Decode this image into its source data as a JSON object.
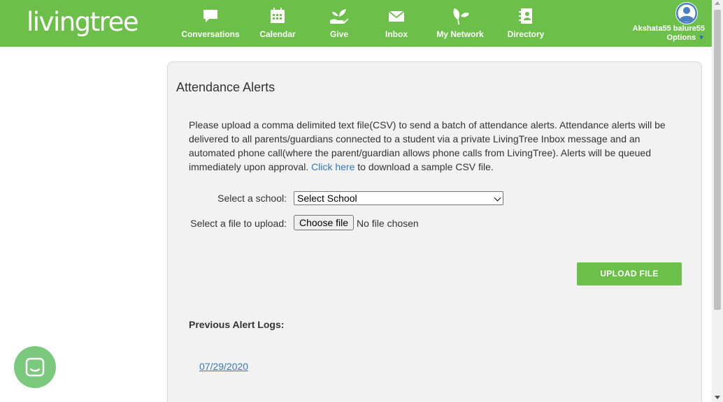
{
  "header": {
    "logo_text": "livingtree",
    "brand_color": "#6cc04a",
    "nav": [
      {
        "label": "Conversations",
        "icon": "speech-bubble-icon"
      },
      {
        "label": "Calendar",
        "icon": "calendar-icon"
      },
      {
        "label": "Give",
        "icon": "hand-plant-icon"
      },
      {
        "label": "Inbox",
        "icon": "envelope-icon"
      },
      {
        "label": "My Network",
        "icon": "leaves-icon"
      },
      {
        "label": "Directory",
        "icon": "contact-book-icon"
      }
    ],
    "user": {
      "name": "Akshata55 balure55",
      "options_label": "Options"
    }
  },
  "main": {
    "title": "Attendance Alerts",
    "description_before_link": "Please upload a comma delimited text file(CSV) to send a batch of attendance alerts. Attendance alerts will be delivered to all parents/guardians connected to a student via a private LivingTree Inbox message and an automated phone call(where the parent/guardian allows phone calls from LivingTree). Alerts will be queued immediately upon approval. ",
    "description_link": "Click here",
    "description_after_link": " to download a sample CSV file.",
    "school_label": "Select a school:",
    "school_selected": "Select School",
    "file_label": "Select a file to upload:",
    "choose_file_label": "Choose file",
    "file_status": "No file chosen",
    "upload_button": "UPLOAD FILE",
    "logs_title": "Previous Alert Logs:",
    "logs": [
      "07/29/2020"
    ]
  },
  "chat": {
    "icon": "chat-icon",
    "color": "#7bc97c"
  }
}
